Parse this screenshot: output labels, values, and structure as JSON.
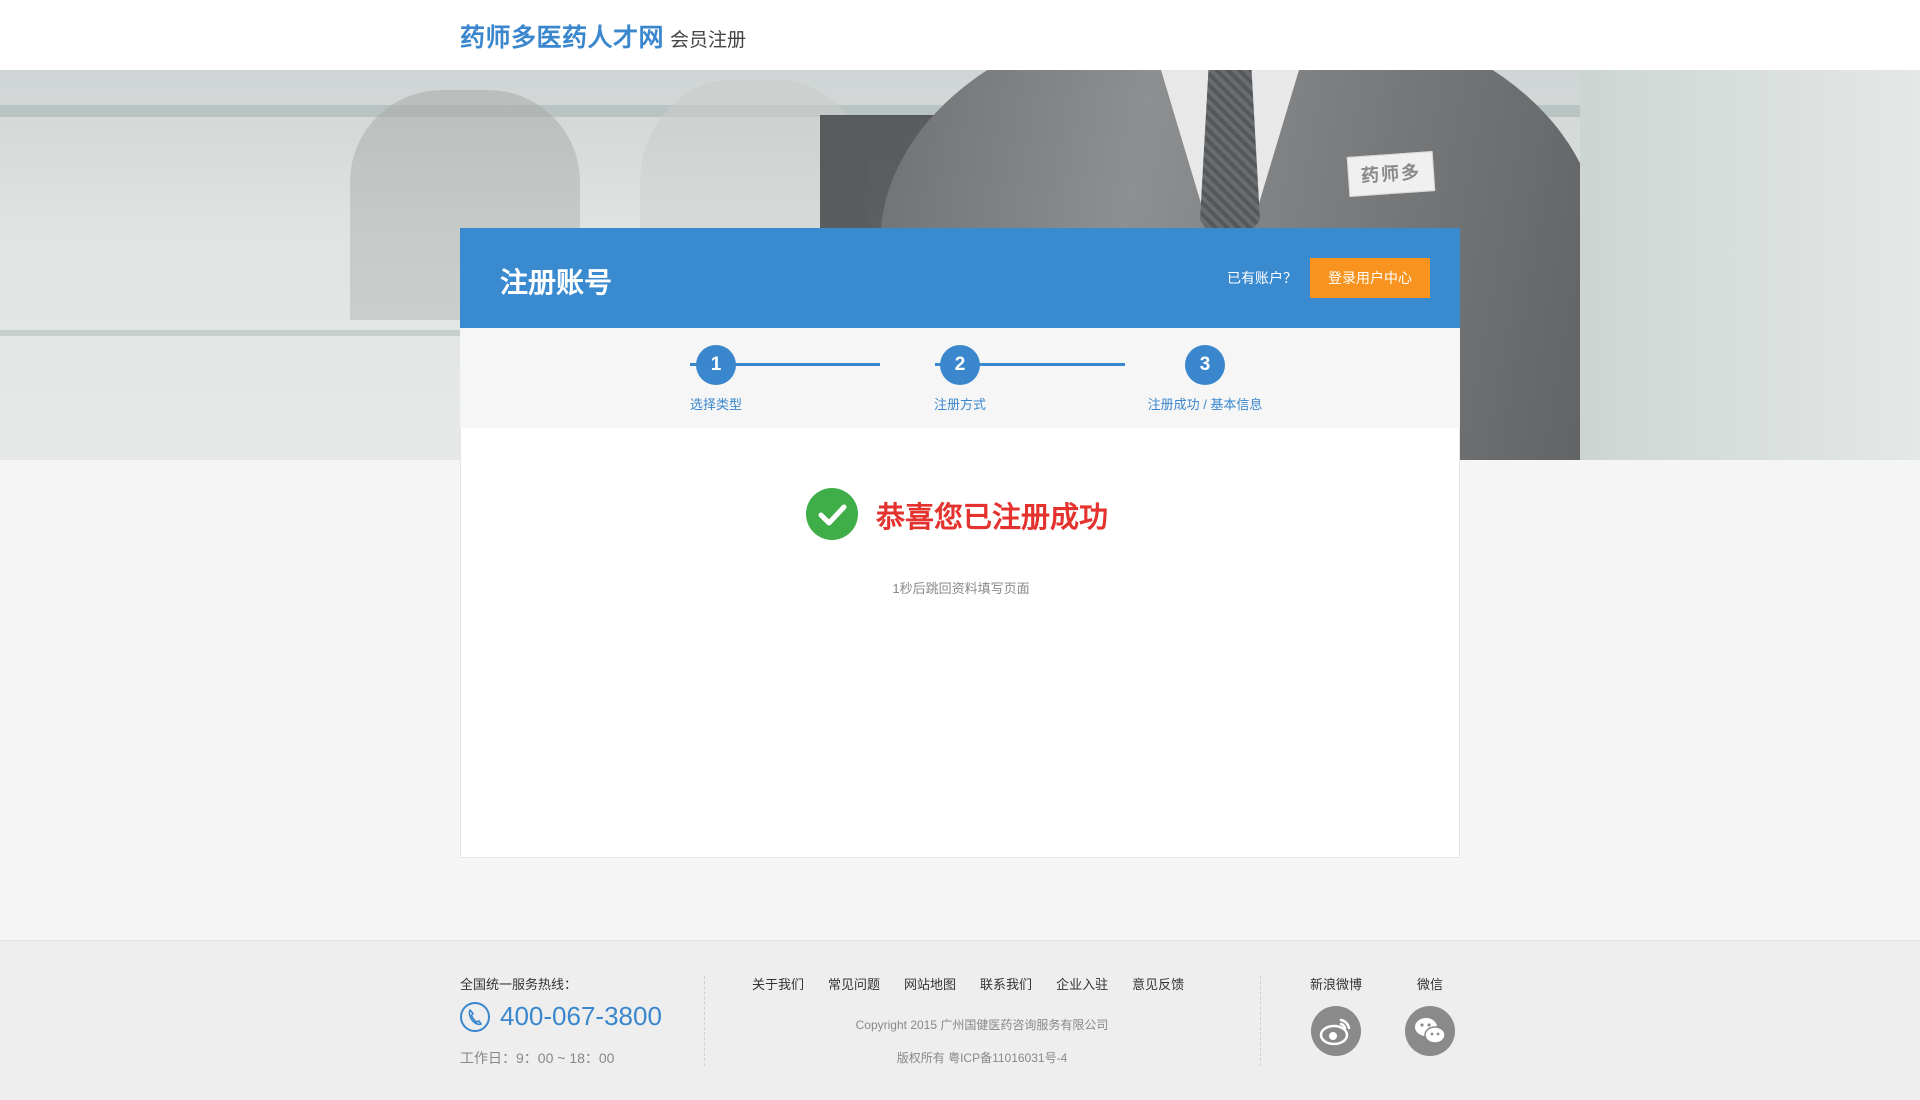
{
  "header": {
    "logo": "药师多医药人才网",
    "subtitle": "会员注册"
  },
  "banner": {
    "badge": "药师多"
  },
  "card": {
    "title": "注册账号",
    "have_account": "已有账户？",
    "login_button": "登录用户中心"
  },
  "steps": [
    {
      "number": "1",
      "label": "选择类型"
    },
    {
      "number": "2",
      "label": "注册方式"
    },
    {
      "number": "3",
      "label": "注册成功 / 基本信息"
    }
  ],
  "result": {
    "message": "恭喜您已注册成功",
    "redirect": "1秒后跳回资料填写页面"
  },
  "footer": {
    "hotline_label": "全国统一服务热线：",
    "phone": "400-067-3800",
    "hours": "工作日：9：00 ~ 18：00",
    "links": [
      "关于我们",
      "常见问题",
      "网站地图",
      "联系我们",
      "企业入驻",
      "意见反馈"
    ],
    "copyright": "Copyright 2015 广州国健医药咨询服务有限公司",
    "icp": "版权所有     粤ICP备11016031号-4",
    "social": [
      {
        "label": "新浪微博",
        "icon": "weibo-icon"
      },
      {
        "label": "微信",
        "icon": "wechat-icon"
      }
    ]
  },
  "colors": {
    "brand_blue": "#3a87cd",
    "header_blue": "#3a8ad0",
    "orange": "#f7931e",
    "success_green": "#3fae49",
    "success_red": "#e4322f"
  }
}
